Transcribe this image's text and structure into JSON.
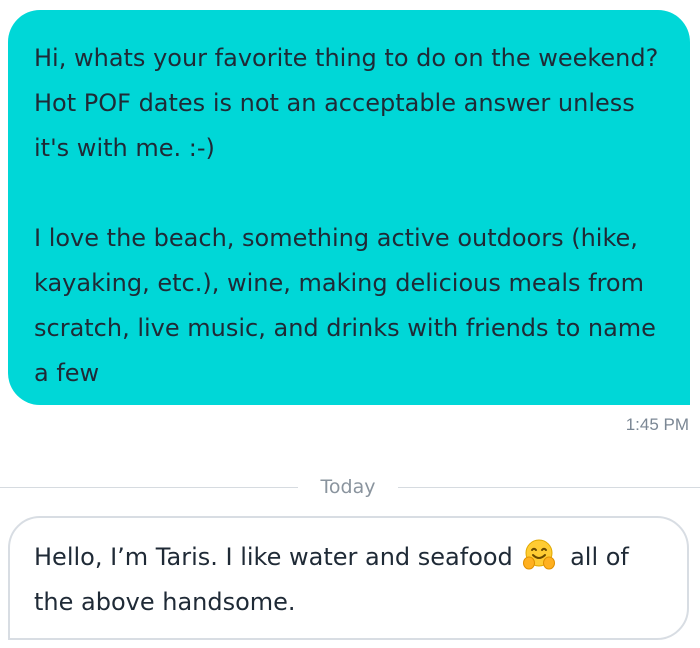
{
  "messages": {
    "sent": {
      "paragraph1": "Hi, whats your favorite thing to do on the weekend? Hot POF dates is not an acceptable answer unless it's with me. :-)",
      "paragraph2": "I love the beach, something active outdoors (hike, kayaking, etc.), wine, making delicious meals from scratch, live music, and drinks with friends to name a few",
      "time": "1:45 PM",
      "bubble_color": "#00d7d7"
    },
    "divider": {
      "label": "Today"
    },
    "received": {
      "text_before_emoji": "Hello, I’m Taris. I like water and seafood",
      "emoji": "hugging-face-icon",
      "text_after_emoji": "all of the above handsome."
    }
  }
}
